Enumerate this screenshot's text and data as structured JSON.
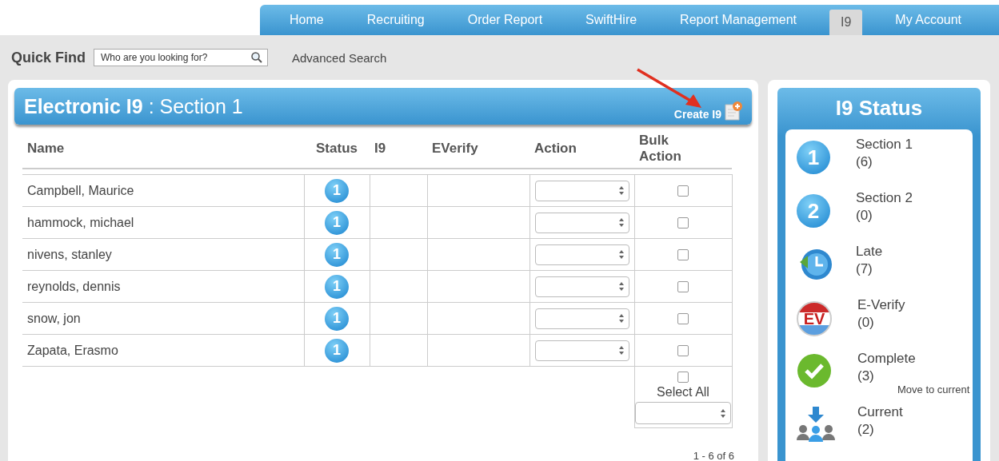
{
  "nav_tabs": [
    {
      "label": "Home",
      "selected": false
    },
    {
      "label": "Recruiting",
      "selected": false
    },
    {
      "label": "Order Report",
      "selected": false
    },
    {
      "label": "SwiftHire",
      "selected": false
    },
    {
      "label": "Report Management",
      "selected": false
    },
    {
      "label": "I9",
      "selected": true
    },
    {
      "label": "My Account",
      "selected": false
    }
  ],
  "quick_find": {
    "label": "Quick Find",
    "placeholder": "Who are you looking for?",
    "advanced_link": "Advanced Search"
  },
  "panel": {
    "title_bold": "Electronic I9",
    "title_rest": ": Section 1",
    "create_label": "Create I9"
  },
  "table": {
    "columns": [
      "Name",
      "Status",
      "I9",
      "EVerify",
      "Action",
      "Bulk Action"
    ],
    "rows": [
      {
        "name": "Campbell, Maurice",
        "status": "1",
        "checked": false
      },
      {
        "name": "hammock, michael",
        "status": "1",
        "checked": false
      },
      {
        "name": "nivens, stanley",
        "status": "1",
        "checked": false
      },
      {
        "name": "reynolds, dennis",
        "status": "1",
        "checked": false
      },
      {
        "name": "snow, jon",
        "status": "1",
        "checked": false
      },
      {
        "name": "Zapata, Erasmo",
        "status": "1",
        "checked": false
      }
    ],
    "select_all": {
      "label": "Select All",
      "checked": false
    },
    "pagination": "1 - 6 of 6"
  },
  "status_panel": {
    "title": "I9 Status",
    "items": [
      {
        "kind": "number",
        "badge": "1",
        "label": "Section 1",
        "count": "(6)"
      },
      {
        "kind": "number",
        "badge": "2",
        "label": "Section 2",
        "count": "(0)"
      },
      {
        "kind": "late",
        "label": "Late",
        "count": "(7)"
      },
      {
        "kind": "everify",
        "badge": "EV",
        "label": "E-Verify",
        "count": "(0)"
      },
      {
        "kind": "complete",
        "label": "Complete",
        "count": "(3)",
        "link": "Move to current"
      },
      {
        "kind": "current",
        "label": "Current",
        "count": "(2)"
      }
    ]
  }
}
